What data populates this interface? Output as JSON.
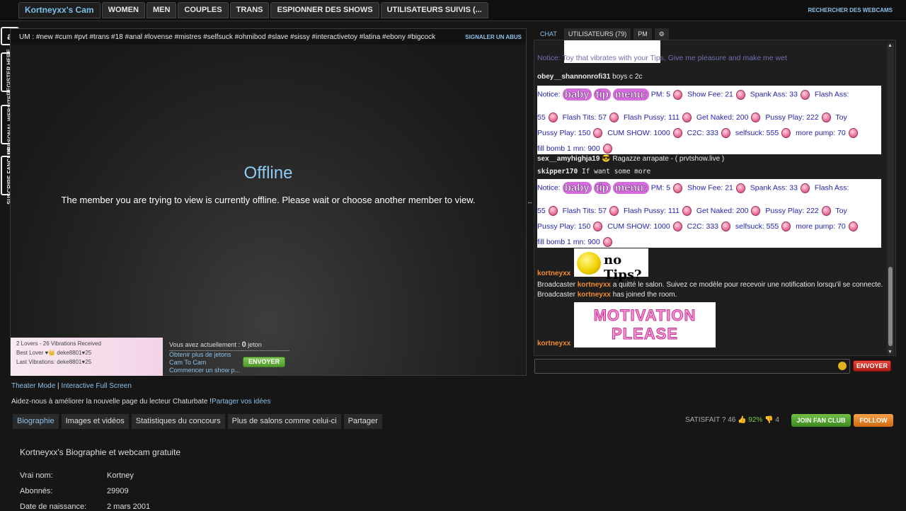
{
  "nav": {
    "tabs": [
      "Kortneyxx's Cam",
      "WOMEN",
      "MEN",
      "COUPLES",
      "TRANS",
      "ESPIONNER DES SHOWS",
      "UTILISATEURS SUIVIS (..."
    ],
    "search_link": "RECHERCHER DES WEBCAMS"
  },
  "rail": {
    "amazon": "a",
    "register": "REGISTER HERE",
    "personal": "PERSONAL WEBSITE",
    "fanclub": "SUSCRIBE FANCLUB"
  },
  "player": {
    "subject": "UM : #new #cum #pvt #trans #18 #anal #lovense #mistres #selfsuck #ohmibod #slave #sissy #interactivetoy #latina #ebony #bigcock",
    "report": "SIGNALER UN ABUS",
    "offline_title": "Offline",
    "offline_message": "The member you are trying to view is currently offline. Please wait or choose another member to view.",
    "tip_lines": [
      "2 Lovers - 26 Vibrations Received",
      "Best Lover ♥👑 deke8801♥25",
      "Last Vibrations: deke8801♥25"
    ],
    "tokens_prefix": "Vous avez actuellement :",
    "tokens_count": "0",
    "tokens_suffix": "jeton",
    "links": [
      "Obtenir plus de jetons",
      "Cam To Cam",
      "Commencer un show p..."
    ],
    "send_label": "ENVOYER"
  },
  "chat": {
    "tabs": [
      "CHAT",
      "UTILISATEURS (79)",
      "PM"
    ],
    "notice_top": "Notice:                                               Toy that vibrates with your Tips, Give me pleasure and make me wet",
    "msg1_user": "obey__shannonrofi31",
    "msg1_text": "boys c 2c",
    "menu_notice": "Notice:",
    "menu_title": [
      "baby",
      "tip",
      "menu:"
    ],
    "menu_row1": [
      "PM: 5",
      "Show Fee: 21",
      "Spank Ass: 33",
      "Flash Ass:"
    ],
    "menu_row2": [
      "55",
      "Flash Tits: 57",
      "Flash Pussy: 111",
      "Get Naked: 200",
      "Pussy Play: 222",
      "Toy"
    ],
    "menu_row3": [
      "Pussy Play: 150",
      "CUM SHOW: 1000",
      "C2C: 333",
      "selfsuck: 555",
      "more pump: 70"
    ],
    "menu_row4": "fill bomb 1 mn: 900",
    "msg2_user": "sex__amyhighja19",
    "msg2_text": "😎 Ragazze arrapate - ( prvtshow.live )",
    "msg3_user": "skipper170",
    "msg3_text": "If want some more",
    "host": "kortneyxx",
    "no_tips": "no Tips?",
    "broadcaster": "Broadcaster",
    "left_msg": "a quitté le salon. Suivez ce modèle pour recevoir une notification lorsqu'il se connecte.",
    "joined_msg": "has joined the room.",
    "motivation": [
      "MOTIVATION",
      "PLEASE"
    ],
    "send_label": "ENVOYER"
  },
  "below": {
    "theater": "Theater Mode",
    "sep": " | ",
    "fullscreen": "Interactive Full Screen",
    "feedback_text": "Aidez-nous à améliorer la nouvelle page du lecteur Chaturbate !",
    "feedback_link": "Partager vos idées",
    "tabs": [
      "Biographie",
      "Images et vidéos",
      "Statistiques du concours",
      "Plus de salons comme celui-ci",
      "Partager"
    ],
    "satisfied_label": "SATISFAIT ?",
    "up_count": "46",
    "pct": "92%",
    "down_count": "4",
    "join": "JOIN FAN CLUB",
    "follow": "FOLLOW",
    "bio_title": "Kortneyxx's Biographie et webcam gratuite",
    "bio": [
      {
        "k": "Vrai nom:",
        "v": "Kortney"
      },
      {
        "k": "Abonnés:",
        "v": "29909"
      },
      {
        "k": "Date de naissance:",
        "v": "2 mars 2001"
      }
    ]
  },
  "colors": {
    "link": "#8cc0e8",
    "accent_green": "#4f9a2a",
    "accent_red": "#b01a14",
    "host": "#f08a30"
  }
}
